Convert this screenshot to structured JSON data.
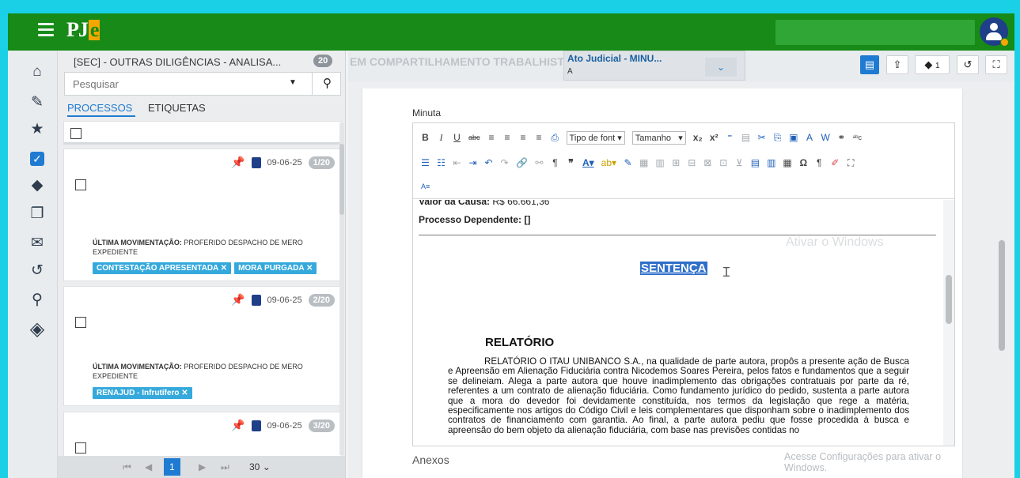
{
  "header": {
    "logo_main": "PJ",
    "logo_accent": "e"
  },
  "sidebar": {
    "items": [
      {
        "name": "home-icon",
        "glyph": "⌂"
      },
      {
        "name": "pencil-icon",
        "glyph": "✎"
      },
      {
        "name": "star-icon",
        "glyph": "★"
      },
      {
        "name": "checkbox-icon",
        "glyph": "✓"
      },
      {
        "name": "tags-icon",
        "glyph": "🏷"
      },
      {
        "name": "copy-icon",
        "glyph": "❐"
      },
      {
        "name": "envelope-icon",
        "glyph": "✉"
      },
      {
        "name": "history-icon",
        "glyph": "↺"
      },
      {
        "name": "search-icon",
        "glyph": "⚲"
      },
      {
        "name": "pje-diamond-icon",
        "glyph": "◈"
      }
    ]
  },
  "panel": {
    "title": "[SEC] - OUTRAS DILIGÊNCIAS - ANALISA...",
    "count": "20",
    "search_placeholder": "Pesquisar",
    "tabs": [
      "PROCESSOS",
      "ETIQUETAS"
    ],
    "cards": [
      {
        "date": "09-06-25",
        "counter": "1/20",
        "movement_label": "ÚLTIMA MOVIMENTAÇÃO:",
        "movement_text": "PROFERIDO DESPACHO DE MERO EXPEDIENTE",
        "tags": [
          "CONTESTAÇÃO APRESENTADA ✕",
          "MORA PURGADA ✕"
        ]
      },
      {
        "date": "09-06-25",
        "counter": "2/20",
        "movement_label": "ÚLTIMA MOVIMENTAÇÃO:",
        "movement_text": "PROFERIDO DESPACHO DE MERO EXPEDIENTE",
        "tags": [
          "RENAJUD - Infrutífero ✕"
        ]
      },
      {
        "date": "09-06-25",
        "counter": "3/20"
      }
    ],
    "pager": {
      "first": "⏮",
      "prev": "◀",
      "current": "1",
      "next": "▶",
      "last": "⏭",
      "page_size": "30"
    }
  },
  "main": {
    "blurred_title": "EM COMPARTILHAMENTO TRABALHISTA",
    "doc_type_line1": "Ato Judicial - MINU...",
    "doc_type_line2": "A",
    "tag_count": "1",
    "minuta_label": "Minuta",
    "toolbar": {
      "font_select": "Tipo de font",
      "size_select": "Tamanho"
    },
    "content": {
      "valor_label": "Valor da Causa:",
      "valor_value": "R$ 66.661,36",
      "dependente": "Processo Dependente: []",
      "sentenca": "SENTENÇA",
      "relatorio": "RELATÓRIO",
      "body": "RELATÓRIO O ITAU UNIBANCO S.A., na qualidade de parte autora, propôs a presente ação de Busca e Apreensão em Alienação Fiduciária contra Nicodemos Soares Pereira, pelos fatos e fundamentos que a seguir se delineiam. Alega a parte autora que houve inadimplemento das obrigações contratuais por parte da ré, referentes a um contrato de alienação fiduciária. Como fundamento jurídico do pedido, sustenta a parte autora que a mora do devedor foi devidamente constituída, nos termos da legislação que rege a matéria, especificamente nos artigos do Código Civil e leis complementares que disponham sobre o inadimplemento dos contratos de financiamento com garantia. Ao final, a parte autora pediu que fosse procedida à busca e apreensão do bem objeto da alienação fiduciária, com base nas previsões contidas no"
    },
    "anexos_label": "Anexos",
    "watermark_title": "Ativar o Windows",
    "watermark_text": "Acesse Configurações para ativar o Windows."
  }
}
